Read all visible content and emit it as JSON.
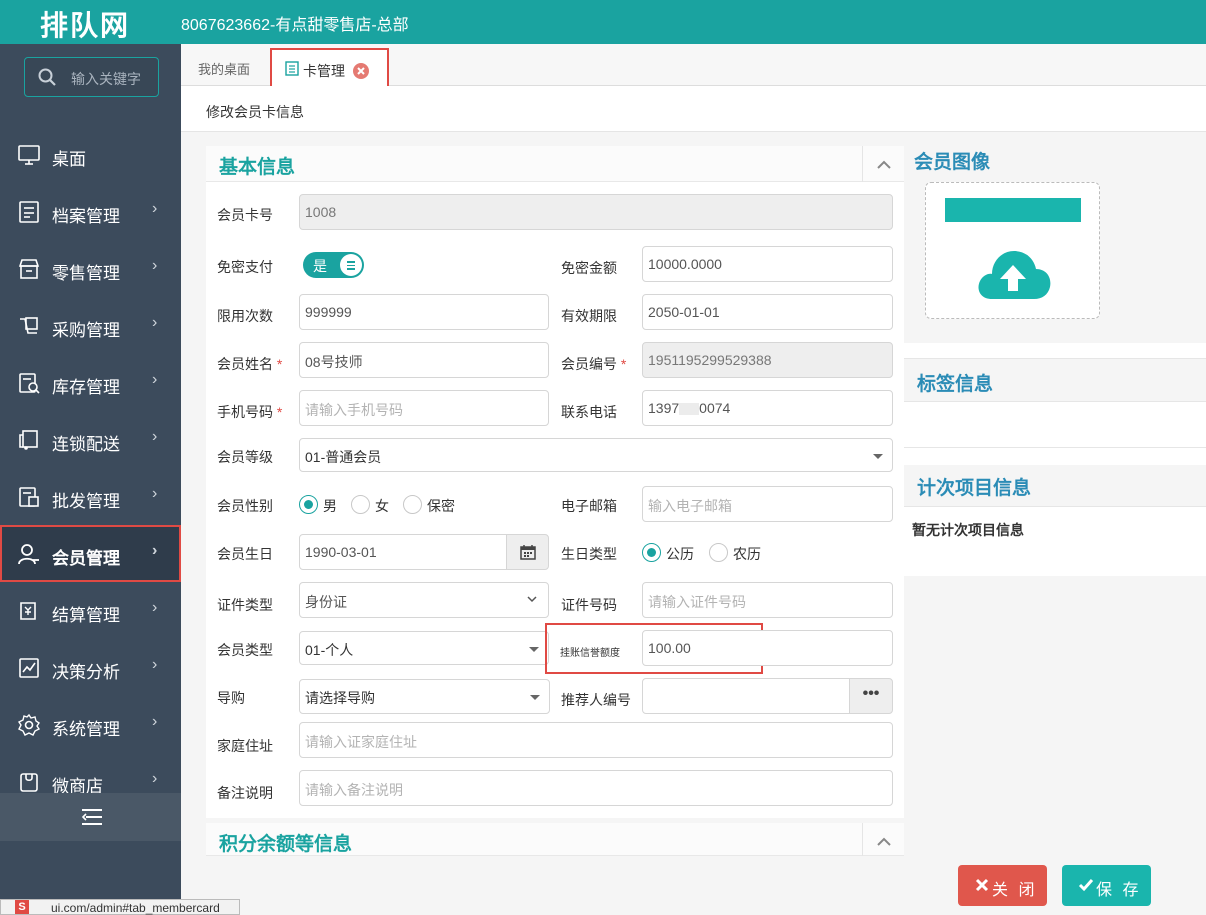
{
  "app": {
    "logo": "排队网",
    "store_title": "8067623662-有点甜零售店-总部"
  },
  "sidebar": {
    "search_placeholder": "输入关键字",
    "items": [
      {
        "label": "桌面",
        "icon": "monitor-icon"
      },
      {
        "label": "档案管理",
        "icon": "archive-icon"
      },
      {
        "label": "零售管理",
        "icon": "store-icon"
      },
      {
        "label": "采购管理",
        "icon": "purchase-icon"
      },
      {
        "label": "库存管理",
        "icon": "inventory-icon"
      },
      {
        "label": "连锁配送",
        "icon": "delivery-icon"
      },
      {
        "label": "批发管理",
        "icon": "wholesale-icon"
      },
      {
        "label": "会员管理",
        "icon": "member-icon",
        "active": true
      },
      {
        "label": "结算管理",
        "icon": "settlement-icon"
      },
      {
        "label": "决策分析",
        "icon": "analysis-icon"
      },
      {
        "label": "系统管理",
        "icon": "settings-icon"
      },
      {
        "label": "微商店",
        "icon": "micro-store-icon"
      }
    ],
    "arrow": "›"
  },
  "tabs": {
    "home": "我的桌面",
    "active": "卡管理"
  },
  "page": {
    "heading": "修改会员卡信息"
  },
  "basic": {
    "title": "基本信息",
    "card_no_label": "会员卡号",
    "card_no": "1008",
    "free_pay_label": "免密支付",
    "free_pay_toggle": "是",
    "free_amount_label": "免密金额",
    "free_amount": "10000.0000",
    "limit_label": "限用次数",
    "limit": "999999",
    "valid_label": "有效期限",
    "valid": "2050-01-01",
    "name_label": "会员姓名",
    "name": "08号技师",
    "member_no_label": "会员编号",
    "member_no": "1951195299529388",
    "mobile_label": "手机号码",
    "mobile_placeholder": "请输入手机号码",
    "phone_label": "联系电话",
    "phone": "1397",
    "phone_tail": "0074",
    "level_label": "会员等级",
    "level": "01-普通会员",
    "gender_label": "会员性别",
    "gender_male": "男",
    "gender_female": "女",
    "gender_secret": "保密",
    "email_label": "电子邮箱",
    "email_placeholder": "输入电子邮箱",
    "birthday_label": "会员生日",
    "birthday": "1990-03-01",
    "birth_type_label": "生日类型",
    "birth_solar": "公历",
    "birth_lunar": "农历",
    "id_type_label": "证件类型",
    "id_type": "身份证",
    "id_no_label": "证件号码",
    "id_no_placeholder": "请输入证件号码",
    "member_type_label": "会员类型",
    "member_type": "01-个人",
    "credit_label": "挂账信誉额度",
    "credit": "100.00",
    "guide_label": "导购",
    "guide_placeholder": "请选择导购",
    "referrer_label": "推荐人编号",
    "referrer_more": "•••",
    "address_label": "家庭住址",
    "address_placeholder": "请输入证家庭住址",
    "remark_label": "备注说明",
    "remark_placeholder": "请输入备注说明",
    "required_mark": "*"
  },
  "points": {
    "title": "积分余额等信息"
  },
  "side": {
    "avatar_title": "会员图像",
    "tags_title": "标签信息",
    "count_title": "计次项目信息",
    "count_empty": "暂无计次项目信息"
  },
  "buttons": {
    "close": "关 闭",
    "save": "保 存"
  },
  "statusbar": {
    "icon": "S",
    "url": "ui.com/admin#tab_membercard"
  },
  "colors": {
    "brand": "#1aa3a0",
    "sidebar": "#3c4b5c",
    "highlight": "#e04a44",
    "side_title": "#2b8cb6"
  }
}
